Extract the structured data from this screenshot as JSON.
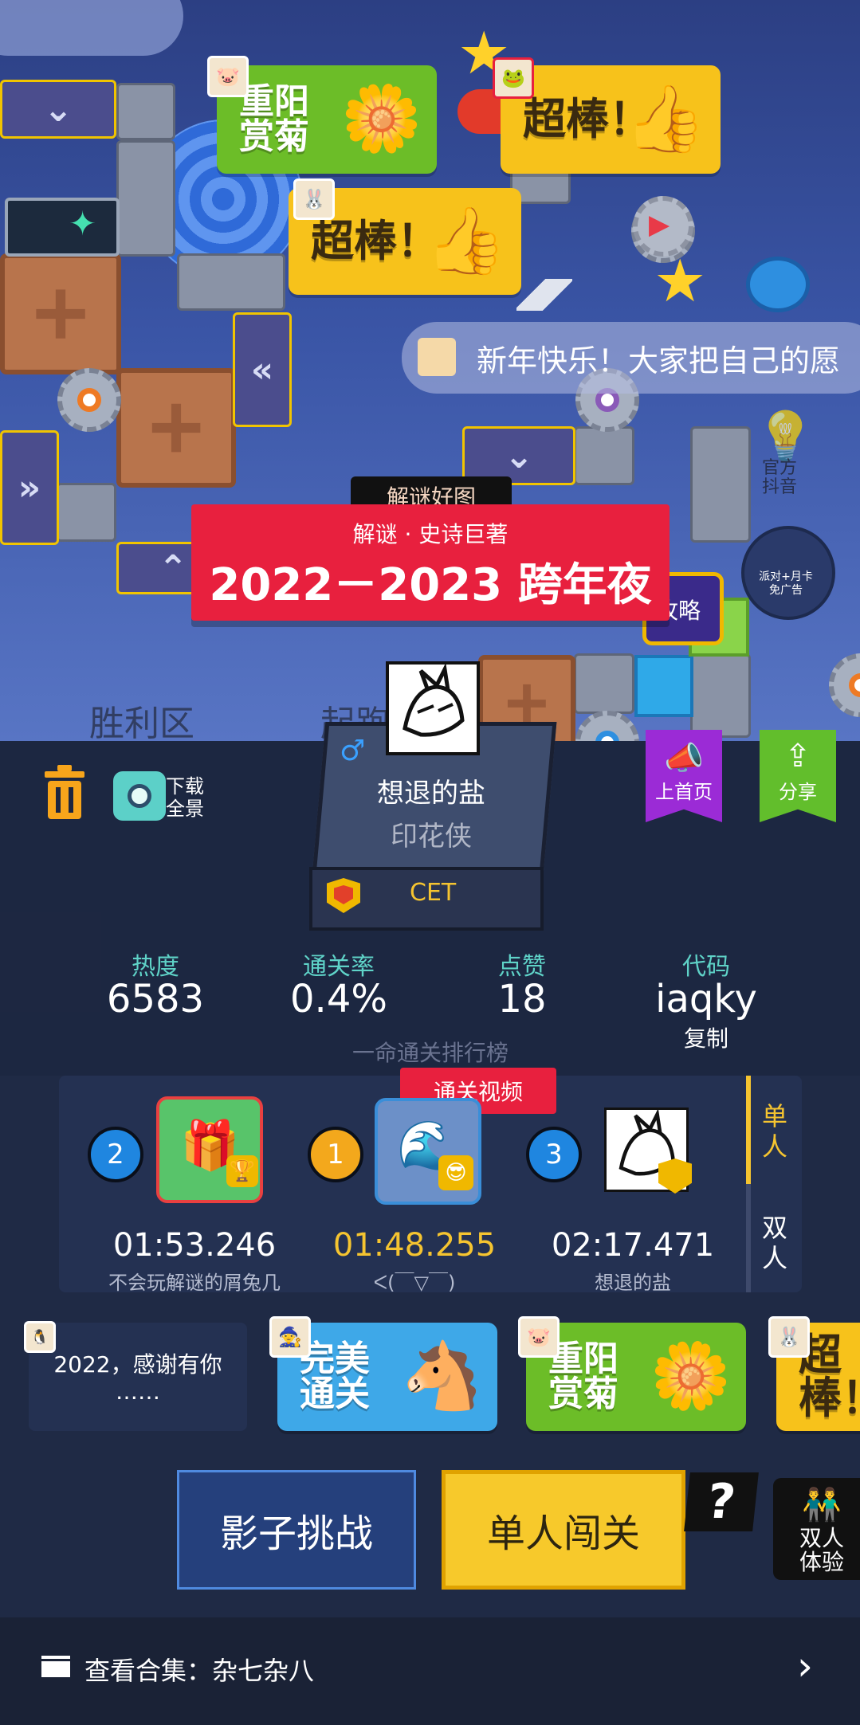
{
  "ticker": {
    "text": "新年快乐！大家把自己的愿"
  },
  "top_right_badges": {
    "official_douyin": "官方\n抖音",
    "ad_promo": "派对+月卡\n免广告",
    "strategy": "攻略"
  },
  "stickers": {
    "chongyang": "重阳\n赏菊",
    "chaobang": "超棒！",
    "wanmei": "完美\n通关"
  },
  "level": {
    "tag": "解谜好图",
    "subtitle": "解谜 · 史诗巨著",
    "title": "2022－2023 跨年夜"
  },
  "zones": {
    "victory": "胜利区",
    "start": "起跑"
  },
  "toolbar": {
    "download_label": "下载\n全景"
  },
  "author": {
    "gender_symbol": "♂",
    "name": "想退的盐",
    "title": "印花侠",
    "badge": "CET"
  },
  "side_buttons": {
    "home": "上首页",
    "share": "分享"
  },
  "stats": {
    "heat_label": "热度",
    "heat_value": "6583",
    "clear_rate_label": "通关率",
    "clear_rate_value": "0.4%",
    "likes_label": "点赞",
    "likes_value": "18",
    "code_label": "代码",
    "code_value": "iaqky",
    "copy_label": "复制"
  },
  "leaderboard": {
    "heading": "一命通关排行榜",
    "video_tag": "通关视频",
    "tabs": {
      "single": "单\n人",
      "duo": "双\n人"
    },
    "entries": [
      {
        "rank": "2",
        "time": "01:53.246",
        "name": "不会玩解谜的屑兔几"
      },
      {
        "rank": "1",
        "time": "01:48.255",
        "name": "ᐸ(￣▽￣)"
      },
      {
        "rank": "3",
        "time": "02:17.471",
        "name": "想退的盐"
      }
    ]
  },
  "recommend": {
    "card1": "2022，感谢有你\n……"
  },
  "actions": {
    "shadow": "影子挑战",
    "solo": "单人闯关",
    "help": "?",
    "duo": "双人\n体验"
  },
  "footer": {
    "collection": "查看合集：杂七杂八"
  },
  "colors": {
    "accent_red": "#e8203e",
    "accent_yellow": "#f5c430",
    "panel": "#243152",
    "teal": "#5fd3c8"
  }
}
